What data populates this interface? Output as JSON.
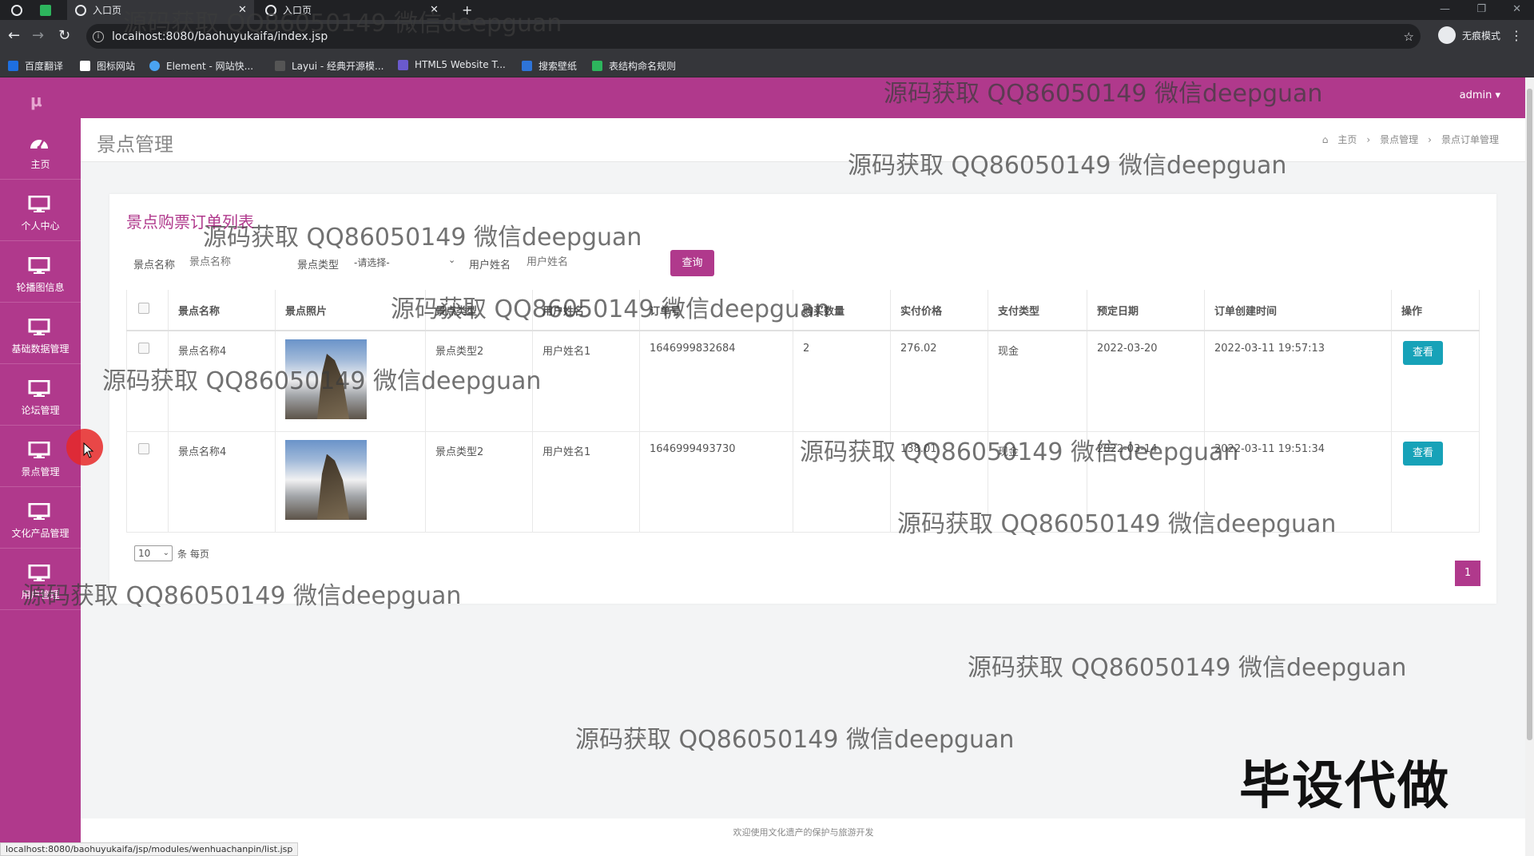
{
  "browser": {
    "tabs": [
      {
        "title": "入口页"
      },
      {
        "title": "入口页"
      }
    ],
    "url": "localhost:8080/baohuyukaifa/index.jsp",
    "incognito_label": "无痕模式",
    "bookmarks": [
      "百度翻译",
      "图标网站",
      "Element - 网站快...",
      "Layui - 经典开源模...",
      "HTML5 Website T...",
      "搜索壁纸",
      "表结构命名规则"
    ],
    "status_url": "localhost:8080/baohuyukaifa/jsp/modules/wenhuachanpin/list.jsp"
  },
  "header": {
    "user": "admin ▾"
  },
  "sidebar": {
    "items": [
      {
        "label": "主页",
        "icon": "dashboard-icon"
      },
      {
        "label": "个人中心",
        "icon": "monitor-icon"
      },
      {
        "label": "轮播图信息",
        "icon": "monitor-icon"
      },
      {
        "label": "基础数据管理",
        "icon": "monitor-icon"
      },
      {
        "label": "论坛管理",
        "icon": "monitor-icon"
      },
      {
        "label": "景点管理",
        "icon": "monitor-icon"
      },
      {
        "label": "文化产品管理",
        "icon": "monitor-icon"
      },
      {
        "label": "用户管理",
        "icon": "monitor-icon"
      }
    ]
  },
  "page": {
    "title": "景点管理",
    "breadcrumb": [
      "主页",
      "景点管理",
      "景点订单管理"
    ]
  },
  "list": {
    "title": "景点购票订单列表",
    "filters": {
      "name_label": "景点名称",
      "name_placeholder": "景点名称",
      "type_label": "景点类型",
      "type_selected": "-请选择-",
      "user_label": "用户姓名",
      "user_placeholder": "用户姓名",
      "query_button": "查询"
    },
    "columns": [
      "",
      "景点名称",
      "景点照片",
      "景点类型",
      "用户姓名",
      "订单号",
      "购买数量",
      "实付价格",
      "支付类型",
      "预定日期",
      "订单创建时间",
      "操作"
    ],
    "rows": [
      {
        "name": "景点名称4",
        "type": "景点类型2",
        "user": "用户姓名1",
        "order_no": "1646999832684",
        "qty": "2",
        "price": "276.02",
        "pay_type": "现金",
        "date": "2022-03-20",
        "created": "2022-03-11 19:57:13",
        "action": "查看"
      },
      {
        "name": "景点名称4",
        "type": "景点类型2",
        "user": "用户姓名1",
        "order_no": "1646999493730",
        "qty": "",
        "price": "138.01",
        "pay_type": "现金",
        "date": "2022-03-14",
        "created": "2022-03-11 19:51:34",
        "action": "查看"
      }
    ],
    "page_size": "10",
    "page_size_suffix": "条 每页",
    "current_page": "1"
  },
  "footer": {
    "text": "欢迎使用文化遗产的保护与旅游开发"
  },
  "overlay": {
    "watermark": "源码获取 QQ86050149 微信deepguan",
    "big_text": "毕设代做"
  }
}
